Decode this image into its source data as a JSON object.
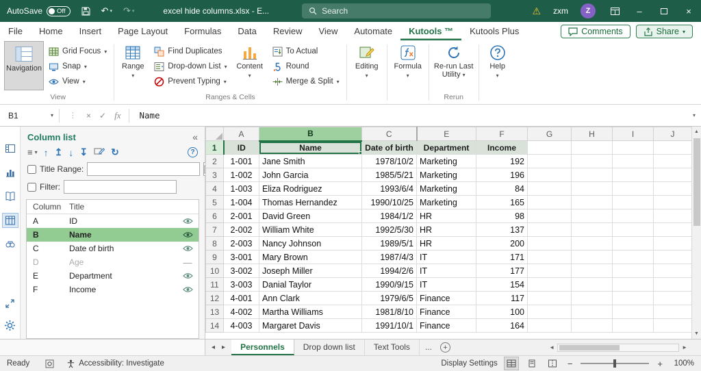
{
  "colors": {
    "titlebar_green": "#1e5e49",
    "accent_green": "#217346",
    "selection_green": "#93cc93",
    "header_fill_green": "#d8e2d8",
    "warning_yellow": "#f7c325",
    "avatar_purple": "#8661c5",
    "toolbar_blue": "#2e75b6"
  },
  "icons": {
    "chevron": "▾",
    "undo": "↶",
    "redo": "↷",
    "warning": "⚠",
    "collapse": "«",
    "move_up": "↑",
    "move_top": "↥",
    "move_down": "↓",
    "move_bottom": "↧",
    "refresh": "↻",
    "help_q": "?",
    "menu_lines": "≡",
    "hidden_dash": "—",
    "close": "×",
    "minimize": "–",
    "check": "✓",
    "cancel": "×",
    "dots": "⋮",
    "scroll_up": "▲",
    "scroll_down": "▼",
    "scroll_left": "◄",
    "scroll_right": "►",
    "tab_prev": "◂",
    "tab_next": "▸",
    "plus": "+",
    "zoom_out": "−",
    "zoom_in": "+"
  },
  "titlebar": {
    "autosave_label": "AutoSave",
    "autosave_state": "Off",
    "doc_title": "excel hide columns.xlsx - E...",
    "search_placeholder": "Search",
    "user_name": "zxm",
    "avatar_initial": "Z"
  },
  "ribbon": {
    "tabs": [
      "File",
      "Home",
      "Insert",
      "Page Layout",
      "Formulas",
      "Data",
      "Review",
      "View",
      "Automate",
      "Kutools ™",
      "Kutools Plus"
    ],
    "active_tab": "Kutools ™",
    "comments_label": "Comments",
    "share_label": "Share",
    "view_group": {
      "label": "View",
      "navigation": "Navigation",
      "grid_focus": "Grid Focus",
      "snap": "Snap",
      "view": "View"
    },
    "ranges_group": {
      "label": "Ranges & Cells",
      "range": "Range",
      "find_duplicates": "Find Duplicates",
      "dropdown_list": "Drop-down List",
      "prevent_typing": "Prevent Typing",
      "content": "Content",
      "to_actual": "To Actual",
      "round": "Round",
      "merge_split": "Merge & Split"
    },
    "editing_label": "Editing",
    "formula_label": "Formula",
    "rerun_group": {
      "label": "Rerun",
      "rerun_last": "Re-run Last Utility"
    },
    "help_label": "Help"
  },
  "formula_bar": {
    "name_box": "B1",
    "fx": "fx",
    "formula": "Name"
  },
  "pane": {
    "title": "Column list",
    "title_range_label": "Title Range:",
    "title_range_value": "",
    "filter_label": "Filter:",
    "filter_value": "",
    "col_header": "Column",
    "title_header": "Title",
    "rows": [
      {
        "col": "A",
        "title": "ID",
        "state": "visible"
      },
      {
        "col": "B",
        "title": "Name",
        "state": "visible",
        "selected": true
      },
      {
        "col": "C",
        "title": "Date of birth",
        "state": "visible"
      },
      {
        "col": "D",
        "title": "Age",
        "state": "hidden"
      },
      {
        "col": "E",
        "title": "Department",
        "state": "visible"
      },
      {
        "col": "F",
        "title": "Income",
        "state": "visible"
      }
    ]
  },
  "sheet": {
    "selected_cell": "B1",
    "hidden_column": "D",
    "columns": [
      "A",
      "B",
      "C",
      "E",
      "F",
      "G",
      "H",
      "I",
      "J"
    ],
    "header_row": {
      "n": "1",
      "id": "ID",
      "name": "Name",
      "dob": "Date of birth",
      "dept": "Department",
      "income": "Income"
    },
    "rows": [
      {
        "n": "2",
        "id": "1-001",
        "name": "Jane Smith",
        "dob": "1978/10/2",
        "dept": "Marketing",
        "income": "192"
      },
      {
        "n": "3",
        "id": "1-002",
        "name": "John Garcia",
        "dob": "1985/5/21",
        "dept": "Marketing",
        "income": "196"
      },
      {
        "n": "4",
        "id": "1-003",
        "name": "Eliza Rodriguez",
        "dob": "1993/6/4",
        "dept": "Marketing",
        "income": "84"
      },
      {
        "n": "5",
        "id": "1-004",
        "name": "Thomas Hernandez",
        "dob": "1990/10/25",
        "dept": "Marketing",
        "income": "165"
      },
      {
        "n": "6",
        "id": "2-001",
        "name": "David Green",
        "dob": "1984/1/2",
        "dept": "HR",
        "income": "98"
      },
      {
        "n": "7",
        "id": "2-002",
        "name": "William White",
        "dob": "1992/5/30",
        "dept": "HR",
        "income": "137"
      },
      {
        "n": "8",
        "id": "2-003",
        "name": "Nancy Johnson",
        "dob": "1989/5/1",
        "dept": "HR",
        "income": "200"
      },
      {
        "n": "9",
        "id": "3-001",
        "name": "Mary Brown",
        "dob": "1987/4/3",
        "dept": "IT",
        "income": "171"
      },
      {
        "n": "10",
        "id": "3-002",
        "name": "Joseph Miller",
        "dob": "1994/2/6",
        "dept": "IT",
        "income": "177"
      },
      {
        "n": "11",
        "id": "3-003",
        "name": "Danial Taylor",
        "dob": "1990/9/15",
        "dept": "IT",
        "income": "154"
      },
      {
        "n": "12",
        "id": "4-001",
        "name": "Ann Clark",
        "dob": "1979/6/5",
        "dept": "Finance",
        "income": "117"
      },
      {
        "n": "13",
        "id": "4-002",
        "name": "Martha Williams",
        "dob": "1981/8/10",
        "dept": "Finance",
        "income": "100"
      },
      {
        "n": "14",
        "id": "4-003",
        "name": "Margaret Davis",
        "dob": "1991/10/1",
        "dept": "Finance",
        "income": "164"
      }
    ]
  },
  "tab_bar": {
    "tabs": [
      {
        "label": "Personnels",
        "active": true
      },
      {
        "label": "Drop down list",
        "active": false
      },
      {
        "label": "Text Tools",
        "active": false
      }
    ],
    "overflow": "..."
  },
  "status_bar": {
    "ready": "Ready",
    "accessibility": "Accessibility: Investigate",
    "display_settings": "Display Settings",
    "zoom_level": "100%"
  }
}
